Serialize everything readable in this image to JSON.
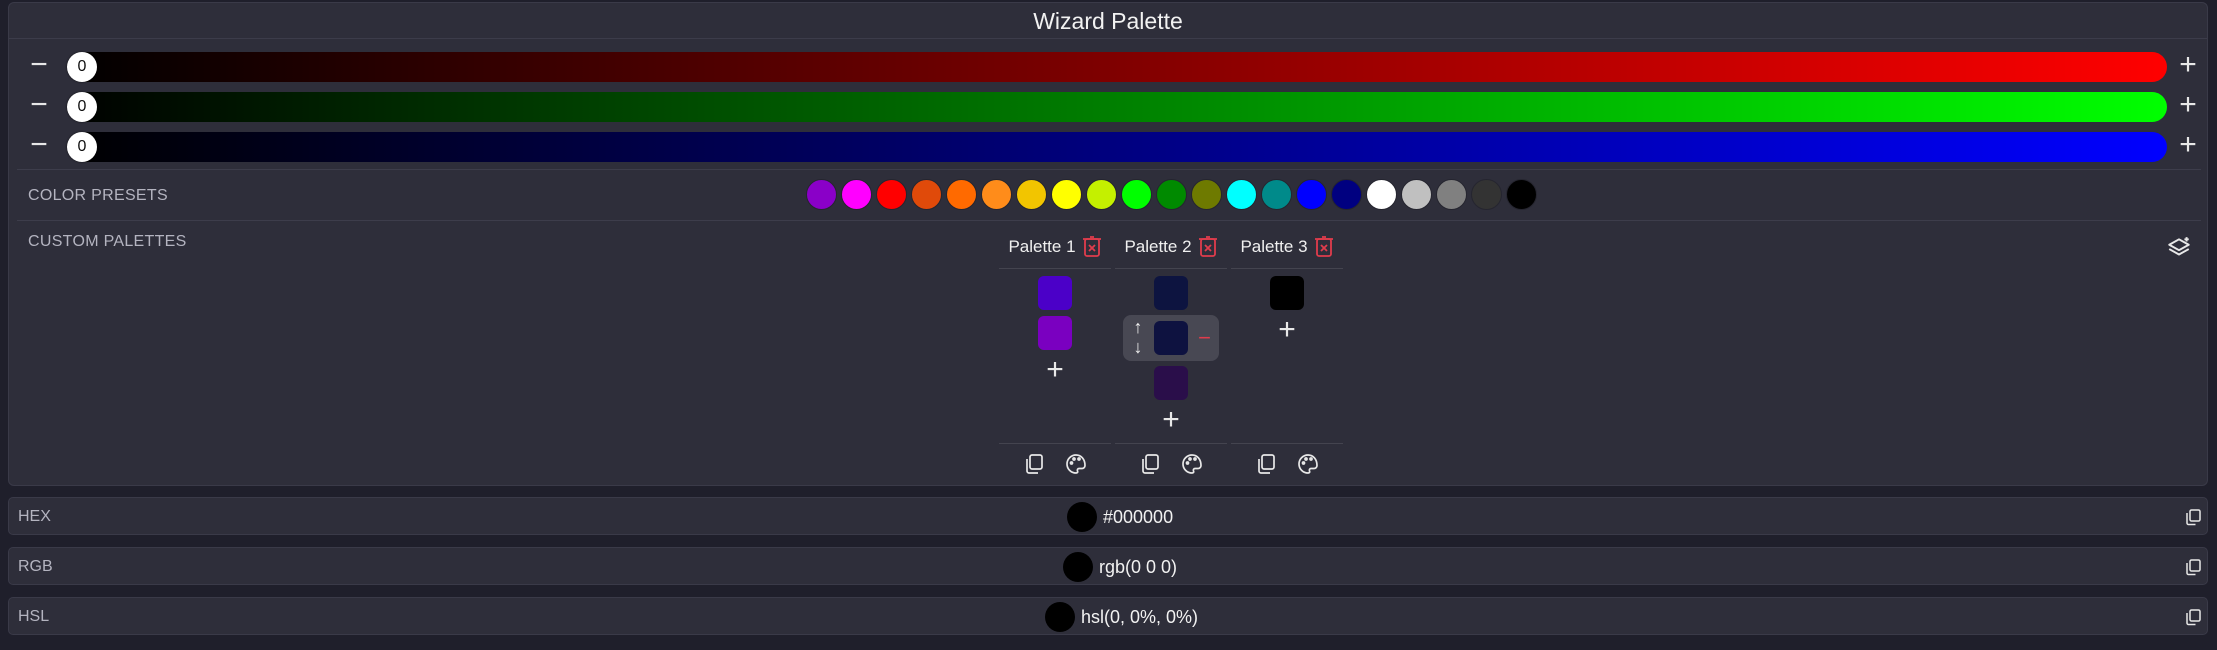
{
  "title": "Wizard Palette",
  "sliders": [
    {
      "channel": "red",
      "value": "0",
      "max_color": "#ff0000"
    },
    {
      "channel": "green",
      "value": "0",
      "max_color": "#00ff00"
    },
    {
      "channel": "blue",
      "value": "0",
      "max_color": "#0000ff"
    }
  ],
  "labels": {
    "presets": "COLOR PRESETS",
    "custom": "CUSTOM PALETTES"
  },
  "presets": [
    "#8a00c8",
    "#ff00ff",
    "#ff0000",
    "#e04a0a",
    "#ff6a00",
    "#ff8c1a",
    "#f2c500",
    "#ffff00",
    "#c4f000",
    "#00ff00",
    "#008a00",
    "#6e7a00",
    "#00ffff",
    "#008a8a",
    "#0000ff",
    "#000080",
    "#ffffff",
    "#c0c0c0",
    "#808080",
    "#333333",
    "#000000"
  ],
  "palettes": [
    {
      "name": "Palette 1",
      "colors": [
        "#4b00c8",
        "#7a00c0"
      ],
      "active_index": -1
    },
    {
      "name": "Palette 2",
      "colors": [
        "#0d1440",
        "#0e1240",
        "#2a0e4a"
      ],
      "active_index": 1
    },
    {
      "name": "Palette 3",
      "colors": [
        "#000000"
      ],
      "active_index": -1
    }
  ],
  "outputs": [
    {
      "label": "HEX",
      "value": "#000000",
      "swatch": "#000000"
    },
    {
      "label": "RGB",
      "value": "rgb(0 0 0)",
      "swatch": "#000000"
    },
    {
      "label": "HSL",
      "value": "hsl(0, 0%, 0%)",
      "swatch": "#000000"
    }
  ],
  "icons": {
    "minus": "minus-icon",
    "plus": "plus-icon",
    "delete": "trash-icon",
    "copy": "copy-icon",
    "palette": "palette-icon",
    "layers": "layers-icon",
    "up": "arrow-up-icon",
    "down": "arrow-down-icon"
  }
}
